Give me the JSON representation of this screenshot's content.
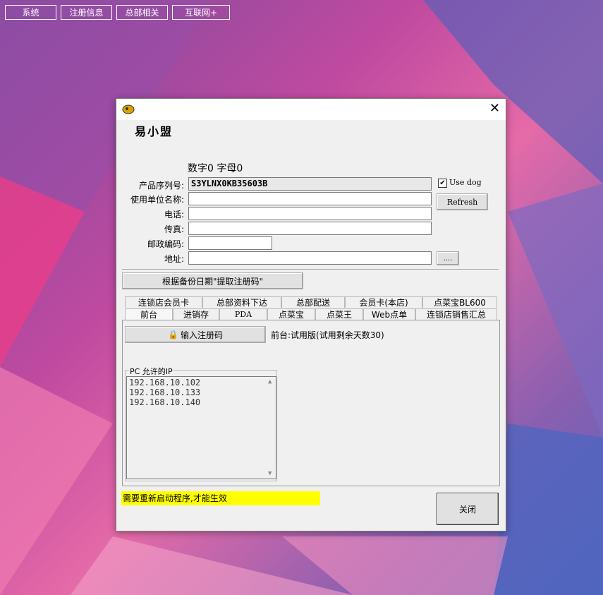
{
  "topnav": {
    "items": [
      "系统",
      "注册信息",
      "总部相关",
      "互联网+"
    ]
  },
  "dialog": {
    "app_title": "易小盟",
    "counts": "数字0 字母0",
    "fields": {
      "serial_label": "产品序列号:",
      "serial_value": "S3YLNX0KB35603B",
      "unit_label": "使用单位名称:",
      "phone_label": "电话:",
      "fax_label": "传真:",
      "zip_label": "邮政编码:",
      "address_label": "地址:"
    },
    "use_dog_label": "Use dog",
    "use_dog_checked": "✔",
    "refresh_label": "Refresh",
    "browse_label": "....",
    "extract_label": "根据备份日期\"提取注册码\"",
    "tabs_row1": [
      "连锁店会员卡",
      "总部资料下达",
      "总部配送",
      "会员卡(本店)",
      "点菜宝BL600"
    ],
    "tabs_row2": [
      "前台",
      "进销存",
      "PDA",
      "点菜宝",
      "点菜王",
      "Web点单",
      "连锁店销售汇总"
    ],
    "enter_code_label": "输入注册码",
    "status_text": "前台:试用版(试用剩余天数30)",
    "ip_group_label": "PC 允许的IP",
    "ips": [
      "192.168.10.102",
      "192.168.10.133",
      "192.168.10.140"
    ],
    "warning": "需要重新启动程序,才能生效",
    "close_label": "关闭"
  }
}
